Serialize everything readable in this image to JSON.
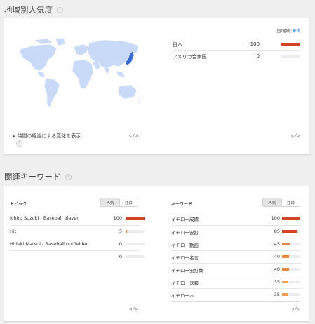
{
  "region_section": {
    "title": "地域別人気度",
    "help": "?",
    "switch": {
      "country": "国/地域",
      "sep": "|",
      "city": "都市"
    },
    "rows": [
      {
        "name": "日本",
        "value": "100",
        "level": 100,
        "color": "#d14424"
      },
      {
        "name": "アメリカ合衆国",
        "value": "0",
        "level": 0,
        "color": "#d14424"
      }
    ],
    "history_label": "時間の経過による変化を表示",
    "history_arrow": "▸",
    "embed": "</>"
  },
  "related_section": {
    "title": "関連キーワード",
    "help": "?",
    "topics": {
      "header": "トピック",
      "seg_on": "人気",
      "seg_off": "注目",
      "rows": [
        {
          "label": "Ichiro Suzuki - Baseball player",
          "value": "100",
          "level": 100,
          "color": "#d14424"
        },
        {
          "label": "Hit",
          "value": "5",
          "level": 5,
          "color": "#e88a3c"
        },
        {
          "label": "Hideki Matsui - Baseball outfielder",
          "value": "0",
          "level": 0,
          "color": "#e88a3c"
        },
        {
          "label": "",
          "value": "0",
          "level": 0,
          "color": "#e88a3c"
        }
      ],
      "embed": "</>"
    },
    "keywords": {
      "header": "キーワード",
      "seg_on": "人気",
      "seg_off": "注目",
      "rows": [
        {
          "label": "イチロー成績",
          "value": "100",
          "level": 100,
          "color": "#d14424"
        },
        {
          "label": "イチロー安打",
          "value": "85",
          "level": 85,
          "color": "#d14424"
        },
        {
          "label": "イチロー動画",
          "value": "45",
          "level": 45,
          "color": "#e88a3c"
        },
        {
          "label": "イチロー名言",
          "value": "40",
          "level": 40,
          "color": "#e88a3c"
        },
        {
          "label": "イチロー安打数",
          "value": "40",
          "level": 40,
          "color": "#e88a3c"
        },
        {
          "label": "イチロー速報",
          "value": "35",
          "level": 35,
          "color": "#ef9f57"
        },
        {
          "label": "イチロー本",
          "value": "35",
          "level": 35,
          "color": "#ef9f57"
        }
      ],
      "embed": "</>"
    }
  }
}
